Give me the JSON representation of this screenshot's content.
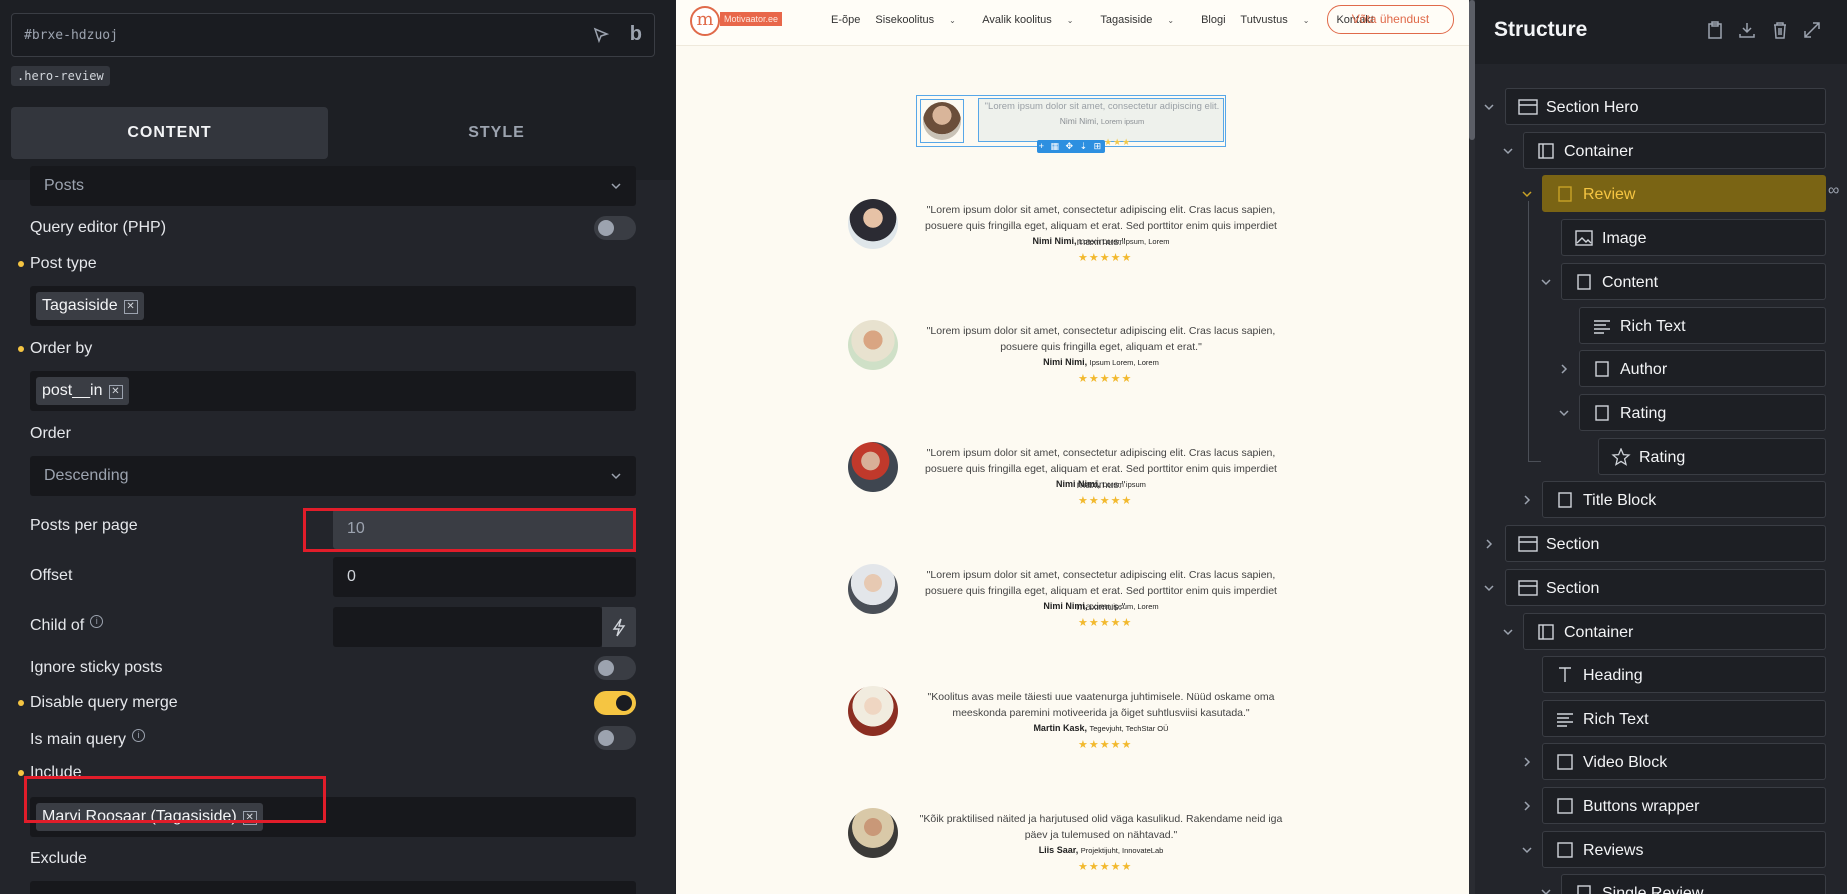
{
  "left_panel": {
    "element_id": "#brxe-hdzuoj",
    "class_chip": ".hero-review",
    "tabs": [
      "CONTENT",
      "STYLE"
    ],
    "query_type_value": "Posts",
    "query_editor_label": "Query editor (PHP)",
    "post_type_label": "Post type",
    "post_type_chip": "Tagasiside",
    "order_by_label": "Order by",
    "order_by_chip": "post__in",
    "order_label": "Order",
    "order_value": "Descending",
    "posts_per_page_label": "Posts per page",
    "posts_per_page_value": "10",
    "offset_label": "Offset",
    "offset_value": "0",
    "child_of_label": "Child of",
    "ignore_sticky_label": "Ignore sticky posts",
    "disable_query_merge_label": "Disable query merge",
    "is_main_query_label": "Is main query",
    "include_label": "Include",
    "include_chip": "Marvi Roosaar (Tagasiside)",
    "exclude_label": "Exclude",
    "toggles": {
      "query_editor": false,
      "ignore_sticky": false,
      "disable_query_merge": true,
      "is_main_query": false
    }
  },
  "canvas": {
    "logo_text": "Motivaator.ee",
    "nav": [
      "E-õpe",
      "Sisekoolitus",
      "Avalik koolitus",
      "Tagasiside",
      "Blogi",
      "Tutvustus",
      "Kontakt"
    ],
    "cta": "Võta ühendust",
    "hero_review": {
      "quote": "\"Lorem ipsum dolor sit amet, consectetur adipiscing elit.",
      "author": "Nimi Nimi,",
      "author_role": "Lorem ipsum",
      "stars": "★★★"
    },
    "toolbar_glyphs": "+ ▦ ✥ ⇣ ⊞",
    "reviews": [
      {
        "quote": "\"Lorem ipsum dolor sit amet, consectetur adipiscing elit. Cras lacus sapien, posuere quis fringilla eget, aliquam et erat. Sed porttitor enim quis imperdiet maximus.\"",
        "author": "Nimi Nimi,",
        "role": "Lorem LoremIpsum, Lorem",
        "stars": "★★★★★"
      },
      {
        "quote": "\"Lorem ipsum dolor sit amet, consectetur adipiscing elit. Cras lacus sapien, posuere quis fringilla eget, aliquam et erat.\"",
        "author": "Nimi Nimi,",
        "role": "Ipsum Lorem, Lorem",
        "stars": "★★★★★"
      },
      {
        "quote": "\"Lorem ipsum dolor sit amet, consectetur adipiscing elit. Cras lacus sapien, posuere quis fringilla eget, aliquam et erat. Sed porttitor enim quis imperdiet maximus.\"",
        "author": "Nimi Nimi,",
        "role": "Lorem ipsum",
        "stars": "★★★★★"
      },
      {
        "quote": "\"Lorem ipsum dolor sit amet, consectetur adipiscing elit. Cras lacus sapien, posuere quis fringilla eget, aliquam et erat. Sed porttitor enim quis imperdiet maximus.\"",
        "author": "Nimi Nimi,",
        "role": "Lorem ipsum, Lorem",
        "stars": "★★★★★"
      },
      {
        "quote": "\"Koolitus avas meile täiesti uue vaatenurga juhtimisele. Nüüd oskame oma meeskonda paremini motiveerida ja õiget suhtlusviisi kasutada.\"",
        "author": "Martin Kask,",
        "role": "Tegevjuht, TechStar OÜ",
        "stars": "★★★★★"
      },
      {
        "quote": "\"Kõik praktilised näited ja harjutused olid väga kasulikud. Rakendame neid iga päev ja tulemused on nähtavad.\"",
        "author": "Liis Saar,",
        "role": "Projektijuht, InnovateLab",
        "stars": "★★★★★"
      }
    ]
  },
  "structure": {
    "title": "Structure",
    "nodes": [
      "Section Hero",
      "Container",
      "Review",
      "Image",
      "Content",
      "Rich Text",
      "Author",
      "Rating",
      "Rating",
      "Title Block",
      "Section",
      "Section",
      "Container",
      "Heading",
      "Rich Text",
      "Video Block",
      "Buttons wrapper",
      "Reviews",
      "Single Review"
    ]
  }
}
